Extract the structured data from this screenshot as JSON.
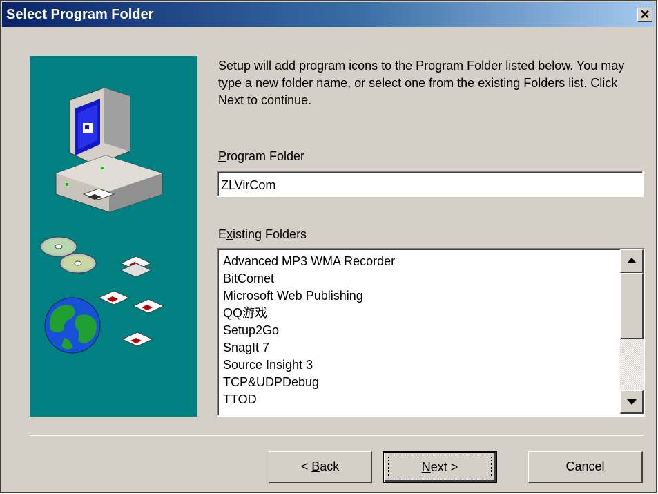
{
  "window": {
    "title": "Select Program Folder",
    "close_glyph": "✕"
  },
  "description": "Setup will add program icons to the Program Folder listed below. You may type a new folder name, or select one from the existing Folders list. Click Next to continue.",
  "program_folder": {
    "label_mnemonic": "P",
    "label_rest": "rogram Folder",
    "value": "ZLVirCom"
  },
  "existing_folders": {
    "label_before": "E",
    "label_mnemonic": "x",
    "label_after": "isting Folders",
    "items": [
      "Advanced MP3 WMA Recorder",
      "BitComet",
      "Microsoft Web Publishing",
      "QQ游戏",
      "Setup2Go",
      "SnagIt 7",
      "Source Insight 3",
      "TCP&UDPDebug",
      "TTOD"
    ],
    "scroll_position": 0.0
  },
  "buttons": {
    "back_prefix": "< ",
    "back_mnemonic": "B",
    "back_rest": "ack",
    "next_mnemonic": "N",
    "next_rest": "ext >",
    "cancel": "Cancel"
  },
  "colors": {
    "title_gradient_start": "#0a246a",
    "title_gradient_end": "#a6caf0",
    "graphic_background": "#008080",
    "dialog_face": "#d4d0c8"
  },
  "icons": [
    "computer-icon",
    "cd-discs-icon",
    "floppy-disks-icon",
    "globe-icon",
    "close-icon",
    "scroll-up-icon",
    "scroll-down-icon"
  ]
}
